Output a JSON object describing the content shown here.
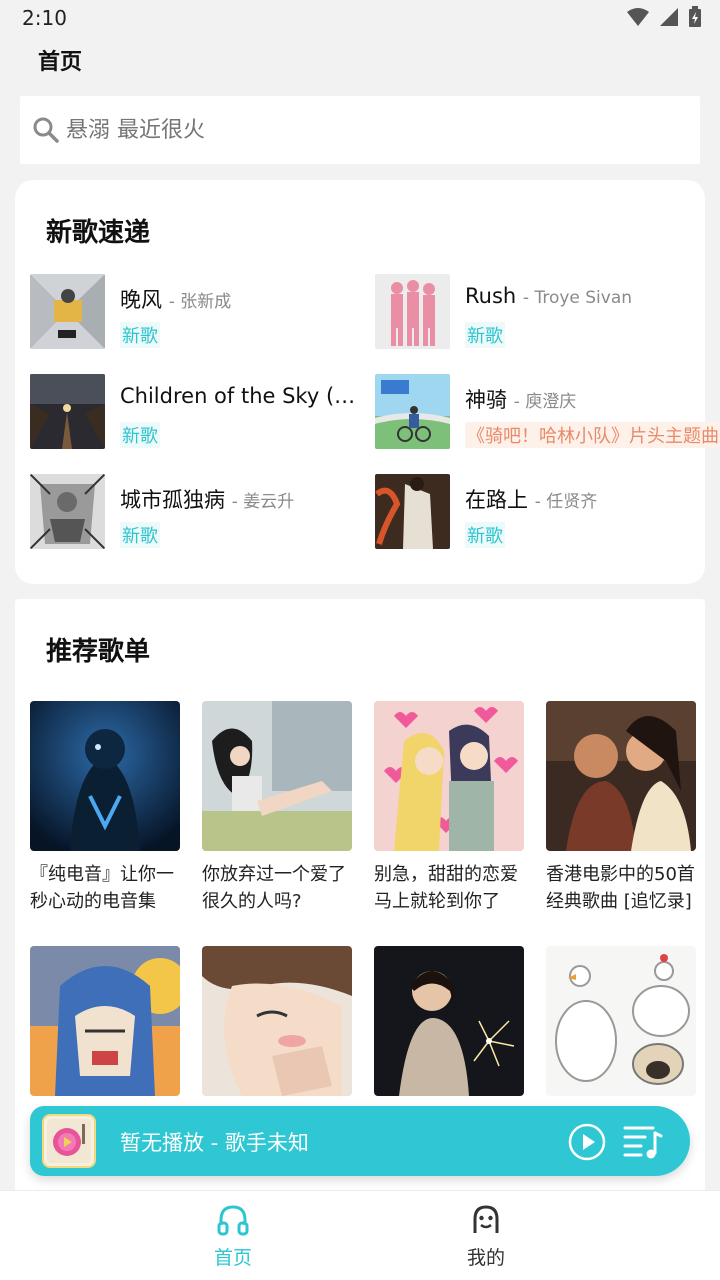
{
  "status": {
    "time": "2:10"
  },
  "header": {
    "title": "首页"
  },
  "search": {
    "placeholder": "悬溺 最近很火"
  },
  "new_songs": {
    "title": "新歌速递",
    "items": [
      {
        "title": "晚风",
        "artist": "- 张新成",
        "tag": "新歌"
      },
      {
        "title": "Rush",
        "artist": "- Troye Sivan",
        "tag": "新歌"
      },
      {
        "title": "Children of the Sky (a...",
        "artist": "",
        "tag": "新歌"
      },
      {
        "title": "神骑",
        "artist": "- 庾澄庆",
        "tag": "《骑吧！哈林小队》片头主题曲"
      },
      {
        "title": "城市孤独病",
        "artist": "- 姜云升",
        "tag": "新歌"
      },
      {
        "title": "在路上",
        "artist": "- 任贤齐",
        "tag": "新歌"
      }
    ]
  },
  "playlists": {
    "title": "推荐歌单",
    "items": [
      {
        "title": "『纯电音』让你一秒心动的电音集"
      },
      {
        "title": "你放弃过一个爱了很久的人吗?"
      },
      {
        "title": "别急，甜甜的恋爱马上就轮到你了"
      },
      {
        "title": "香港电影中的50首经典歌曲 [追忆录]"
      },
      {
        "title": ""
      },
      {
        "title": ""
      },
      {
        "title": ""
      },
      {
        "title": ""
      }
    ]
  },
  "player": {
    "now_playing": "暂无播放 - 歌手未知"
  },
  "nav": {
    "home": "首页",
    "mine": "我的"
  },
  "colors": {
    "accent": "#2bc6d0",
    "player_bg": "#2ec7d3",
    "background": "#f2f2f2"
  }
}
